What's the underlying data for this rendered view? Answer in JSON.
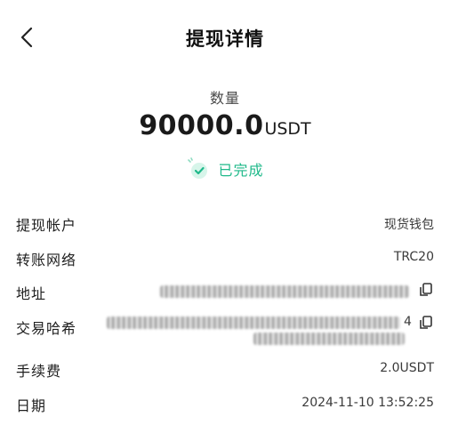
{
  "header": {
    "title": "提现详情",
    "back_icon": "chevron-left-icon"
  },
  "amount": {
    "label": "数量",
    "value": "90000.0",
    "unit": "USDT"
  },
  "status": {
    "text": "已完成",
    "icon": "check-circle-icon",
    "color": "#1fb98a"
  },
  "details": {
    "account": {
      "label": "提现帐户",
      "value": "现货钱包"
    },
    "network": {
      "label": "转账网络",
      "value": "TRC20"
    },
    "address": {
      "label": "地址",
      "value": "",
      "copy_icon": "copy-icon"
    },
    "txhash": {
      "label": "交易哈希",
      "value_suffix": "4",
      "copy_icon": "copy-icon"
    },
    "fee": {
      "label": "手续费",
      "value": "2.0USDT"
    },
    "date": {
      "label": "日期",
      "value": "2024-11-10 13:52:25"
    }
  }
}
